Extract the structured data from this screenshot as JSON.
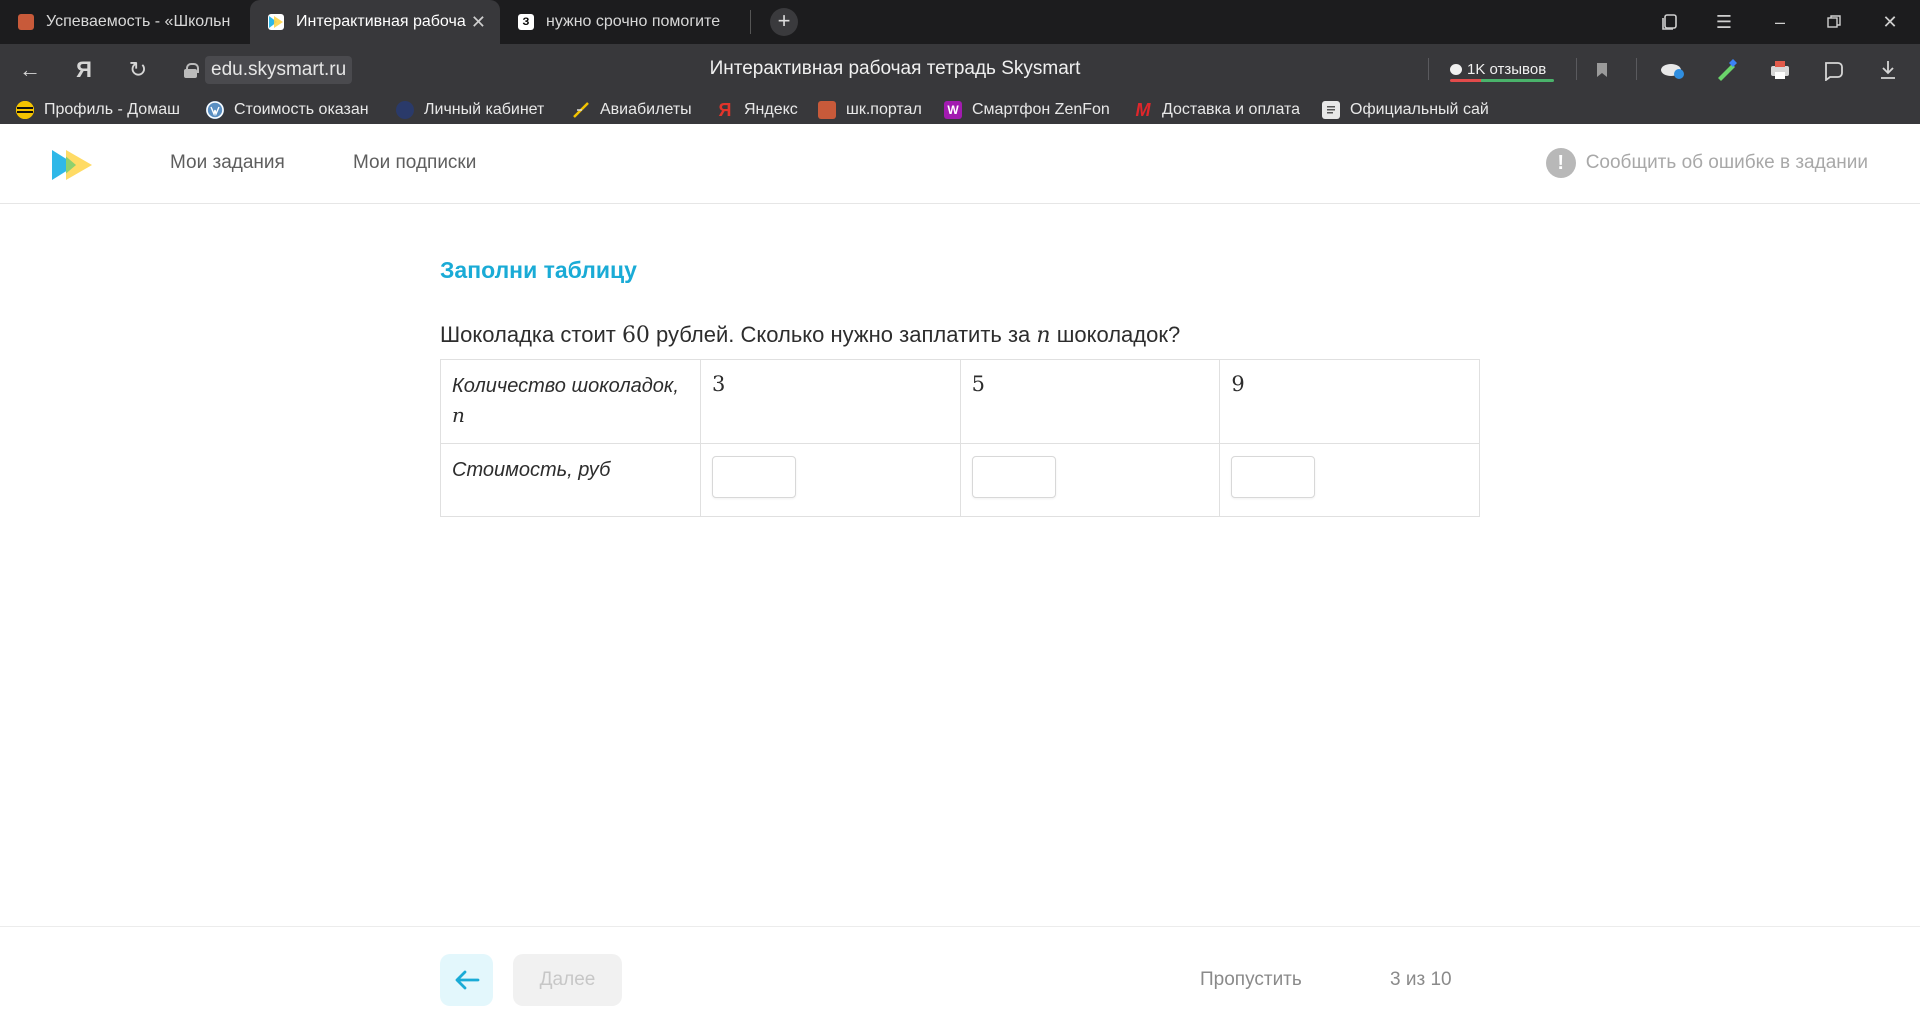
{
  "browser": {
    "tabs": [
      {
        "title": "Успеваемость - «Школьн",
        "active": false
      },
      {
        "title": "Интерактивная рабоча",
        "active": true
      },
      {
        "title": "нужно срочно помогите",
        "active": false
      }
    ],
    "url": "edu.skysmart.ru",
    "page_title": "Интерактивная рабочая тетрадь Skysmart",
    "reviews_label": "1K отзывов",
    "tab3_favicon_text": "З",
    "bookmarks": [
      {
        "label": "Профиль - Домаш",
        "icon": "beeline-icon",
        "color": "#f5c400"
      },
      {
        "label": "Стоимость оказан",
        "icon": "wordpress-icon",
        "color": "#5a8fc2"
      },
      {
        "label": "Личный кабинет",
        "icon": "cabinet-icon",
        "color": "#2a3a6a"
      },
      {
        "label": "Авиабилеты",
        "icon": "plane-icon",
        "color": "#f2c200"
      },
      {
        "label": "Яндекс",
        "icon": "yandex-icon",
        "color": "#e2342b"
      },
      {
        "label": "шк.портал",
        "icon": "school-portal-icon",
        "color": "#c85a3a"
      },
      {
        "label": "Смартфон ZenFon",
        "icon": "wildberries-icon",
        "color": "#a21bb0"
      },
      {
        "label": "Доставка и оплата",
        "icon": "m-video-icon",
        "color": "#e0262b"
      },
      {
        "label": "Официальный сай",
        "icon": "document-icon",
        "color": "#e8e8e8"
      }
    ],
    "bookmark_glyphs": {
      "wildberries": "W",
      "mvideo": "M",
      "yandex": "Я"
    }
  },
  "site": {
    "nav": {
      "my_tasks": "Мои задания",
      "my_subscriptions": "Мои подписки"
    },
    "report_error": "Сообщить об ошибке в задании",
    "brand_colors": {
      "accent": "#1aabd6",
      "logo_blue": "#2fb8e8",
      "logo_yellow": "#ffd54a"
    }
  },
  "task": {
    "title": "Заполни таблицу",
    "text_before": "Шоколадка стоит ",
    "price": "60",
    "text_middle": " рублей. Сколько нужно заплатить за ",
    "variable": "n",
    "text_after": " шоколадок?",
    "table": {
      "row1_label": "Количество шоколадок,",
      "row1_var": "n",
      "row2_label": "Стоимость, руб",
      "values": [
        "3",
        "5",
        "9"
      ],
      "answers": [
        "",
        "",
        ""
      ]
    }
  },
  "footer": {
    "next_label": "Далее",
    "skip_label": "Пропустить",
    "progress": "3 из 10"
  }
}
